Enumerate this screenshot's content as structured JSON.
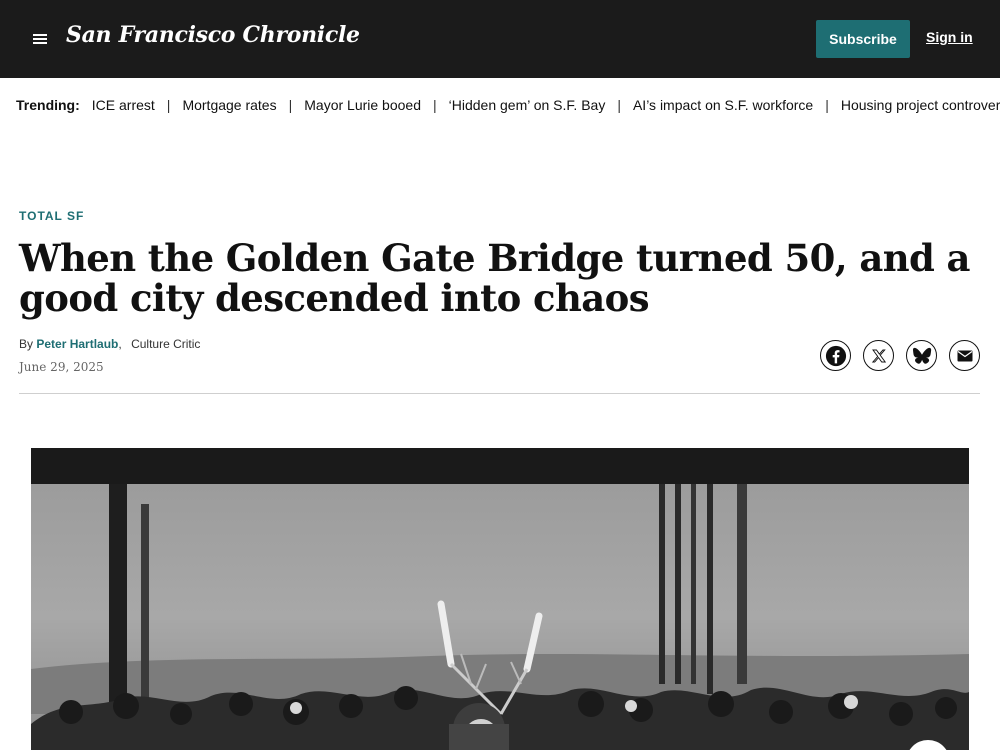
{
  "header": {
    "logo": "San Francisco Chronicle",
    "subscribe_label": "Subscribe",
    "signin_label": "Sign in",
    "menu_icon": "hamburger-menu-icon"
  },
  "trending": {
    "label": "Trending:",
    "items": [
      "ICE arrest",
      "Mortgage rates",
      "Mayor Lurie booed",
      "‘Hidden gem’ on S.F. Bay",
      "AI’s impact on S.F. workforce",
      "Housing project controversy"
    ],
    "separator": "|"
  },
  "article": {
    "kicker": "TOTAL SF",
    "headline": "When the Golden Gate Bridge turned 50, and a good city descended into chaos",
    "byline_prefix": "By",
    "author": "Peter Hartlaub",
    "author_suffix": ",",
    "role": "Culture Critic",
    "date": "June 29, 2025"
  },
  "share": {
    "icons": [
      "facebook-icon",
      "x-icon",
      "bluesky-icon",
      "email-icon"
    ]
  },
  "colors": {
    "topbar": "#1b1b1b",
    "accent": "#1e6e73",
    "kicker": "#1e6e73"
  }
}
